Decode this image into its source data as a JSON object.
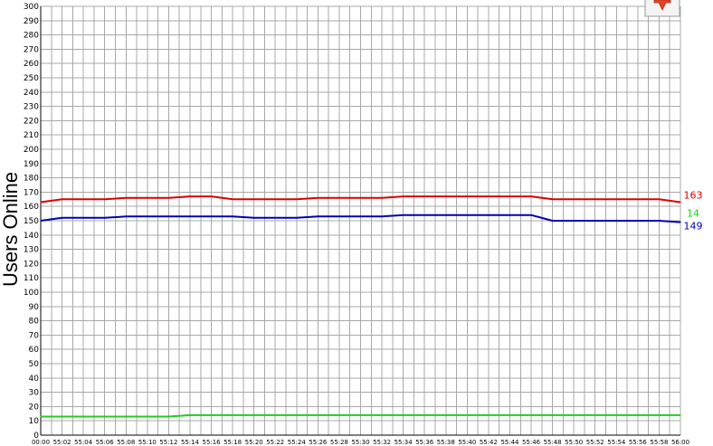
{
  "chart_data": {
    "type": "line",
    "ylabel": "Users Online",
    "xlabel": "",
    "title": "",
    "ylim": [
      0,
      300
    ],
    "y_ticks": [
      0,
      10,
      20,
      30,
      40,
      50,
      60,
      70,
      80,
      90,
      100,
      110,
      120,
      130,
      140,
      150,
      160,
      170,
      180,
      190,
      200,
      210,
      220,
      230,
      240,
      250,
      260,
      270,
      280,
      290,
      300
    ],
    "x": [
      "00:00",
      "55:02",
      "55:04",
      "55:06",
      "55:08",
      "55:10",
      "55:12",
      "55:14",
      "55:16",
      "55:18",
      "55:20",
      "55:22",
      "55:24",
      "55:26",
      "55:28",
      "55:30",
      "55:32",
      "55:34",
      "55:36",
      "55:38",
      "55:40",
      "55:42",
      "55:44",
      "55:46",
      "55:48",
      "55:50",
      "55:52",
      "55:54",
      "55:56",
      "55:58",
      "56:00"
    ],
    "grid": true,
    "series": [
      {
        "color": "#dd0000",
        "end_label": "163",
        "values": [
          163,
          165,
          165,
          165,
          166,
          166,
          166,
          167,
          167,
          165,
          165,
          165,
          165,
          166,
          166,
          166,
          166,
          167,
          167,
          167,
          167,
          167,
          167,
          167,
          165,
          165,
          165,
          165,
          165,
          165,
          163
        ]
      },
      {
        "color": "#22cc22",
        "end_label": "14",
        "values": [
          13,
          13,
          13,
          13,
          13,
          13,
          13,
          14,
          14,
          14,
          14,
          14,
          14,
          14,
          14,
          14,
          14,
          14,
          14,
          14,
          14,
          14,
          14,
          14,
          14,
          14,
          14,
          14,
          14,
          14,
          14
        ]
      },
      {
        "color": "#0000bb",
        "end_label": "149",
        "values": [
          150,
          152,
          152,
          152,
          153,
          153,
          153,
          153,
          153,
          153,
          152,
          152,
          152,
          153,
          153,
          153,
          153,
          154,
          154,
          154,
          154,
          154,
          154,
          154,
          150,
          150,
          150,
          150,
          150,
          150,
          149
        ]
      }
    ],
    "corner_button_icon": "red-down-arrow-icon"
  },
  "colors": {
    "grid": "#a8a8a8",
    "plot_background": "#ffffff",
    "axis": "#000000"
  }
}
